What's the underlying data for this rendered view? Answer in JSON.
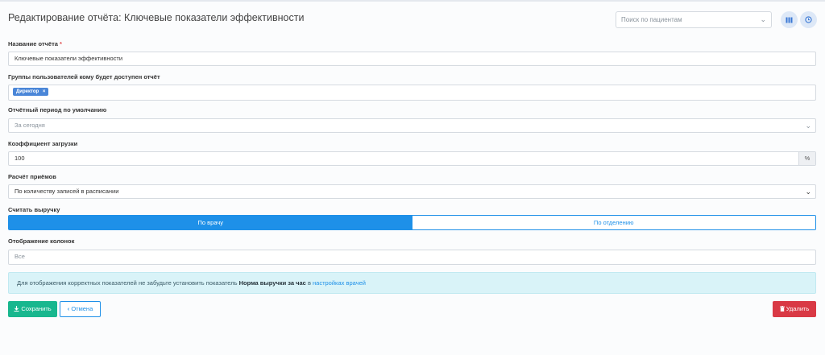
{
  "header": {
    "title": "Редактирование отчёта: Ключевые показатели эффективности",
    "search_placeholder": "Поиск по пациентам",
    "columns_icon": "columns-icon",
    "clock_icon": "clock-icon"
  },
  "form": {
    "report_name": {
      "label": "Название отчёта",
      "required_mark": "*",
      "value": "Ключевые показатели эффективности"
    },
    "user_groups": {
      "label": "Группы пользователей кому будет доступен отчёт",
      "tags": [
        "Директор"
      ],
      "tag_remove": "×"
    },
    "default_period": {
      "label": "Отчётный период по умолчанию",
      "value": "За сегодня"
    },
    "load_coefficient": {
      "label": "Коэффициент загрузки",
      "value": "100",
      "addon": "%"
    },
    "appointments_calc": {
      "label": "Расчёт приёмов",
      "value": "По количеству записей в расписании"
    },
    "revenue": {
      "label": "Считать выручку",
      "options": [
        "По врачу",
        "По отделению"
      ],
      "selected": "По врачу"
    },
    "columns_display": {
      "label": "Отображение колонок",
      "value": "Все"
    }
  },
  "alert": {
    "text_before": "Для отображения корректных показателей не забудьте установить показатель ",
    "bold": "Норма выручки за час",
    "text_mid": " в ",
    "link": "настройках врачей"
  },
  "buttons": {
    "save": "Сохранить",
    "cancel": "Отмена",
    "delete": "Удалить"
  },
  "colors": {
    "primary": "#1e90e8",
    "success": "#18b78e",
    "danger": "#d93945",
    "tag": "#4a86d8",
    "info_bg": "#d9f3f8"
  }
}
